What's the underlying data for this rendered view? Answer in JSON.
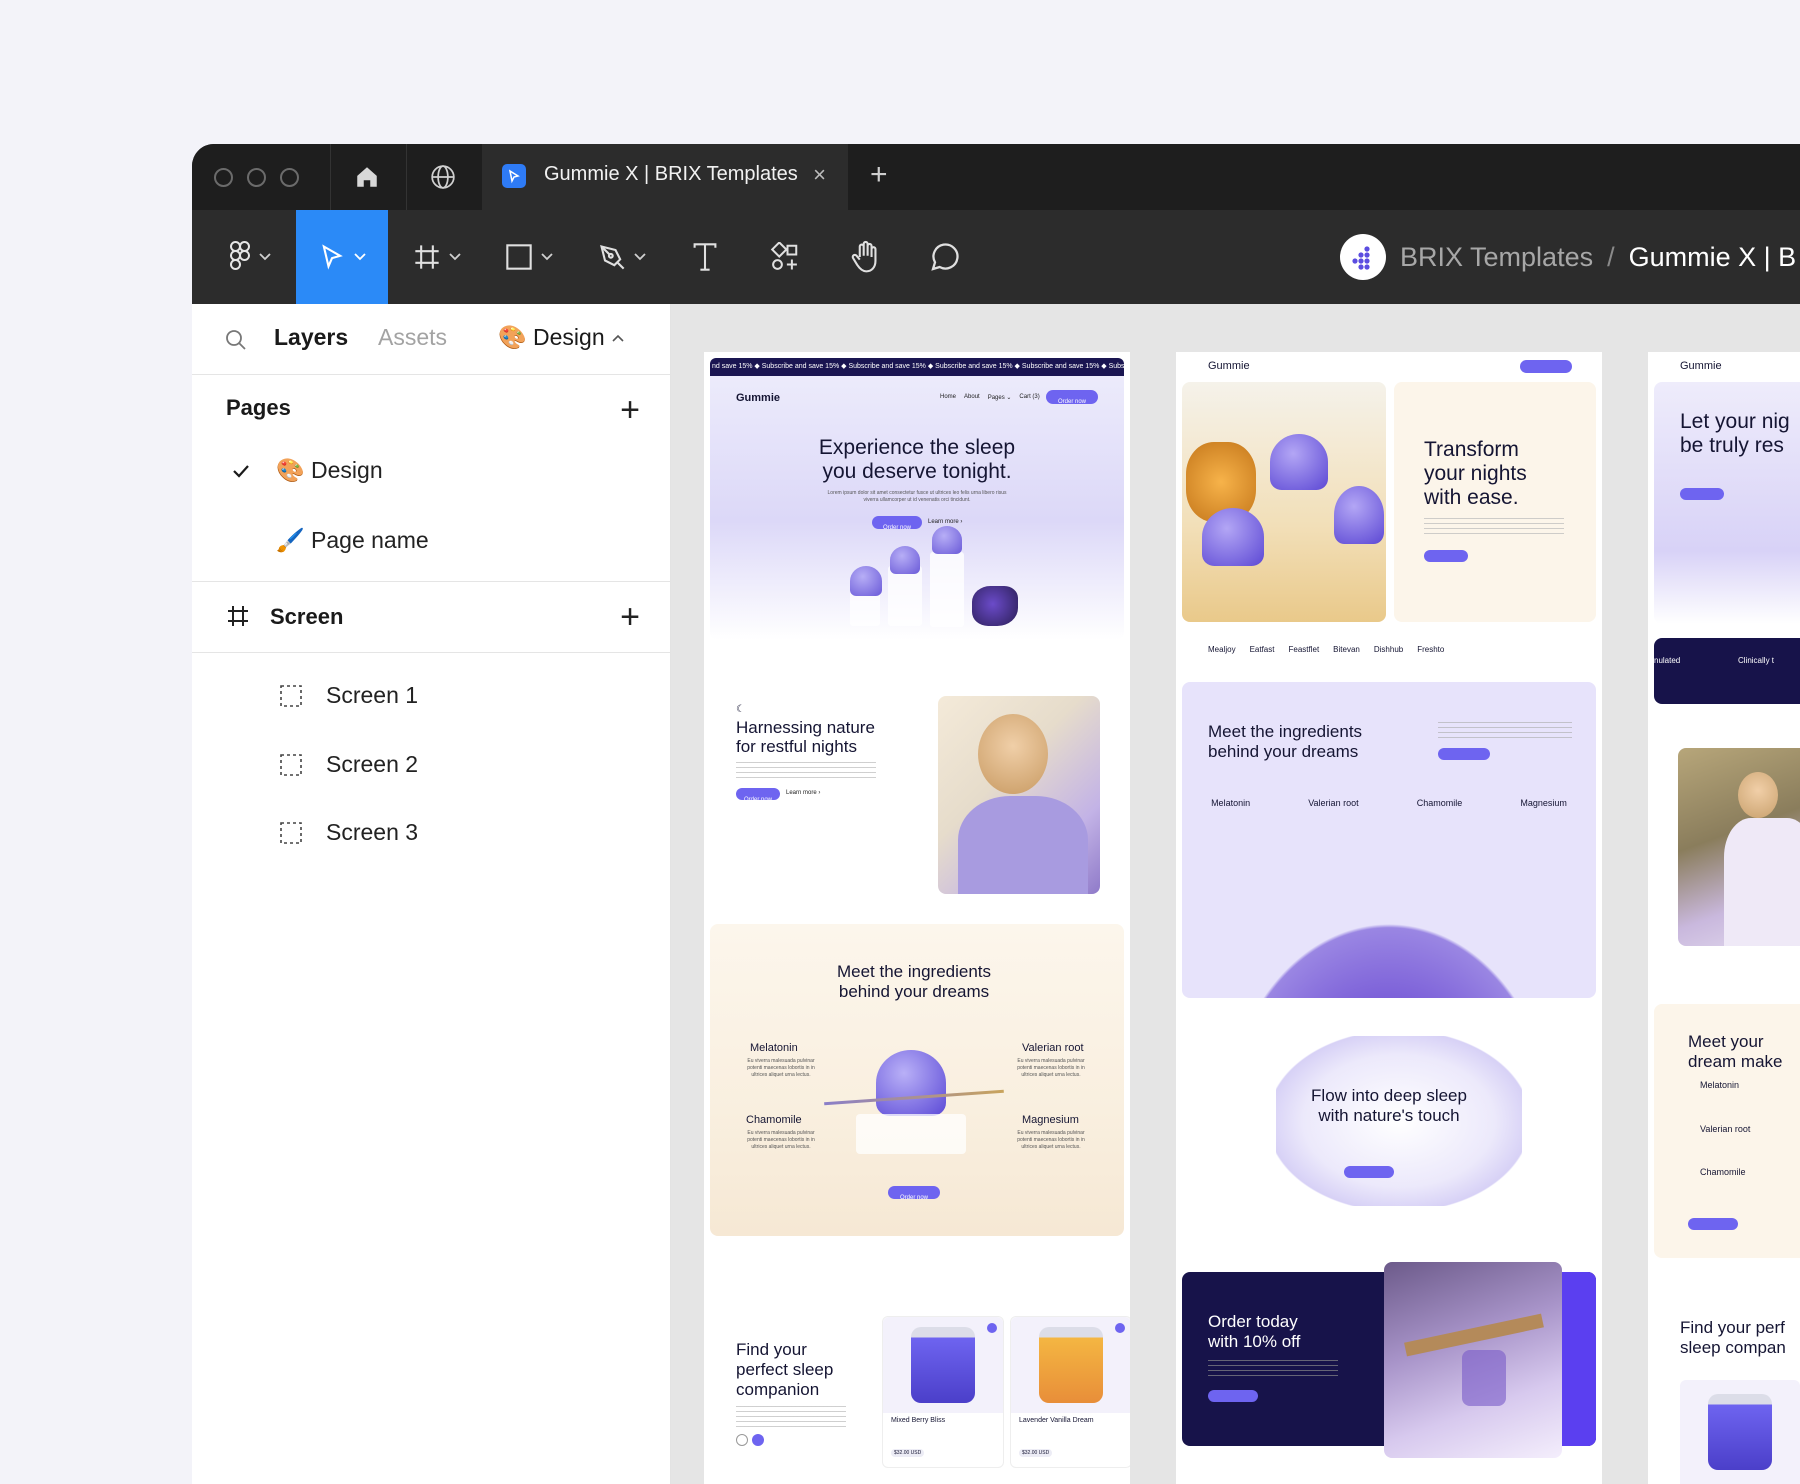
{
  "titlebar": {
    "tab_title": "Gummie X | BRIX Templates",
    "tab_icon": "figma-file-icon",
    "close_glyph": "×",
    "new_tab_glyph": "+"
  },
  "toolbar": {
    "tools": [
      "figma-menu",
      "move-tool",
      "frame-tool",
      "shape-tool",
      "pen-tool",
      "text-tool",
      "resources-tool",
      "hand-tool",
      "comment-tool"
    ],
    "team": "BRIX Templates",
    "separator": "/",
    "file": "Gummie X | B"
  },
  "panel": {
    "tabs": {
      "layers": "Layers",
      "assets": "Assets",
      "design": "🎨 Design"
    },
    "pages_title": "Pages",
    "pages": [
      {
        "label": "🎨 Design",
        "checked": true
      },
      {
        "label": "🖌️ Page name",
        "checked": false
      }
    ],
    "screen_title": "Screen",
    "screens": [
      "Screen 1",
      "Screen 2",
      "Screen 3"
    ]
  },
  "canvas": {
    "f1": {
      "marquee": "nd save 15%  ◆  Subscribe and save 15%  ◆  Subscribe and save 15%  ◆  Subscribe and save 15%  ◆  Subscribe and save 15%  ◆  Subscribe",
      "brand": "Gummie",
      "nav": [
        "Home",
        "About",
        "Pages ⌄",
        "Cart (3)"
      ],
      "nav_cta": "Order now",
      "hero_title_1": "Experience the sleep",
      "hero_title_2": "you deserve tonight.",
      "hero_body": "Lorem ipsum dolor sit amet consectetur fusce ut ultrices leo felis urna libero risus viverra ullamcorper ut id venenatis orci tincidunt.",
      "cta": "Order now",
      "learn": "Learn more ›",
      "nature_title_1": "Harnessing nature",
      "nature_title_2": "for restful nights",
      "ingred_title_1": "Meet the ingredients",
      "ingred_title_2": "behind your dreams",
      "ingredients": [
        "Melatonin",
        "Valerian root",
        "Chamomile",
        "Magnesium"
      ],
      "ingred_body": "Eu viverra malesuada pulvinar potenti maecenas lobortis in in ultrices aliquet urna lectus.",
      "find_title_1": "Find your",
      "find_title_2": "perfect sleep",
      "find_title_3": "companion",
      "products": [
        {
          "name": "Mixed Berry Bliss",
          "price": "$32.00 USD"
        },
        {
          "name": "Lavender Vanilla Dream",
          "price": "$32.00 USD"
        }
      ]
    },
    "f2": {
      "brand": "Gummie",
      "transform_1": "Transform",
      "transform_2": "your nights",
      "transform_3": "with ease.",
      "logos": [
        "Mealjoy",
        "Eatfast",
        "Feastflet",
        "Bitevan",
        "Dishhub",
        "Freshto"
      ],
      "ingred_title_1": "Meet the ingredients",
      "ingred_title_2": "behind your dreams",
      "ingredients": [
        "Melatonin",
        "Valerian root",
        "Chamomile",
        "Magnesium"
      ],
      "flow_1": "Flow into deep sleep",
      "flow_2": "with nature's touch",
      "order_1": "Order today",
      "order_2": "with 10% off"
    },
    "f3": {
      "brand": "Gummie",
      "hero_1": "Let your nig",
      "hero_2": "be truly res",
      "strip_left": "nulated",
      "strip_right": "Clinically t",
      "meet_1": "Meet your",
      "meet_2": "dream make",
      "list": [
        "Melatonin",
        "Valerian root",
        "Chamomile"
      ],
      "find_1": "Find your perf",
      "find_2": "sleep compan"
    }
  },
  "colors": {
    "accent": "#2b8af7",
    "brand_purple": "#6e64f0",
    "dark_navy": "#17134a"
  }
}
